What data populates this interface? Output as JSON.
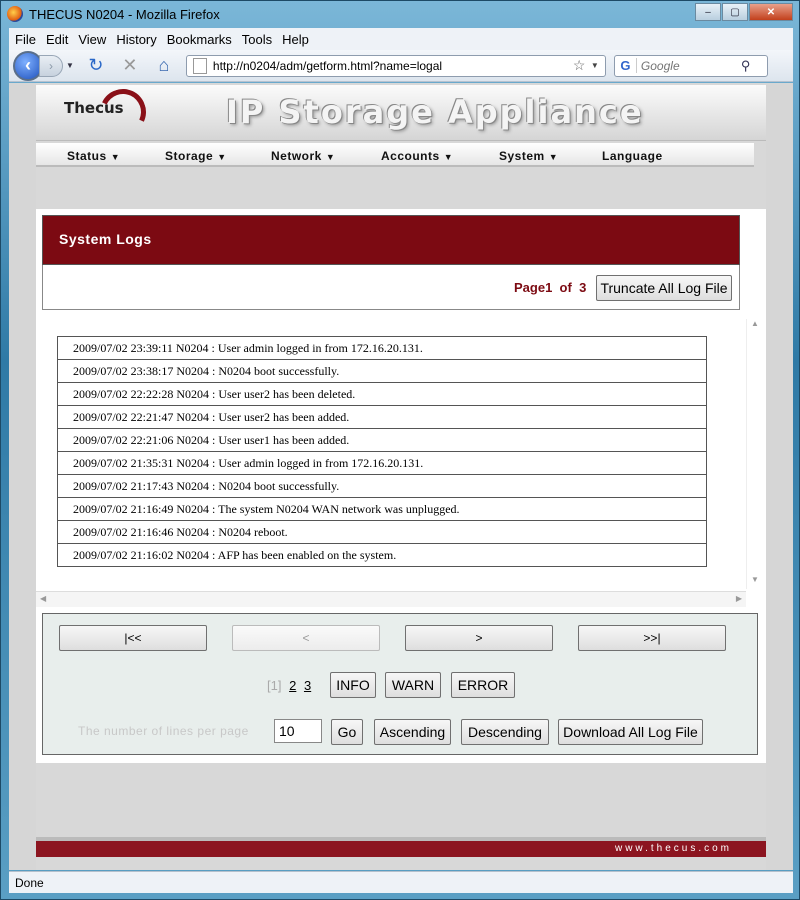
{
  "window": {
    "title": "THECUS N0204 - Mozilla Firefox",
    "buttons": {
      "minimize": "–",
      "maximize": "▢",
      "close": "✕"
    }
  },
  "menubar": {
    "items": [
      "File",
      "Edit",
      "View",
      "History",
      "Bookmarks",
      "Tools",
      "Help"
    ]
  },
  "navbar": {
    "url": "http://n0204/adm/getform.html?name=logal",
    "search_placeholder": "Google"
  },
  "header": {
    "logo": "Thecus",
    "tagline": "IP Storage Appliance"
  },
  "mainnav": {
    "items": [
      {
        "label": "Status",
        "arrow": true
      },
      {
        "label": "Storage",
        "arrow": true
      },
      {
        "label": "Network",
        "arrow": true
      },
      {
        "label": "Accounts",
        "arrow": true
      },
      {
        "label": "System",
        "arrow": true
      },
      {
        "label": "Language",
        "arrow": false
      }
    ]
  },
  "logs": {
    "title": "System Logs",
    "page_label": "Page",
    "page_current": "1",
    "page_of": "of",
    "page_total": "3",
    "truncate_label": "Truncate All Log File",
    "entries": [
      "2009/07/02 23:39:11 N0204 : User admin logged in from 172.16.20.131.",
      "2009/07/02 23:38:17 N0204 : N0204 boot successfully.",
      "2009/07/02 22:22:28 N0204 : User user2 has been deleted.",
      "2009/07/02 22:21:47 N0204 : User user2 has been added.",
      "2009/07/02 22:21:06 N0204 : User user1 has been added.",
      "2009/07/02 21:35:31 N0204 : User admin logged in from 172.16.20.131.",
      "2009/07/02 21:17:43 N0204 : N0204 boot successfully.",
      "2009/07/02 21:16:49 N0204 : The system N0204 WAN network was unplugged.",
      "2009/07/02 21:16:46 N0204 : N0204 reboot.",
      "2009/07/02 21:16:02 N0204 : AFP has been enabled on the system."
    ]
  },
  "controls": {
    "first": "|<<",
    "prev": "<",
    "next": ">",
    "last": ">>|",
    "page_current": "[1]",
    "page_links": [
      "2",
      "3"
    ],
    "info": "INFO",
    "warn": "WARN",
    "error": "ERROR",
    "lines_label": "The number of lines per page",
    "lines_value": "10",
    "go": "Go",
    "ascending": "Ascending",
    "descending": "Descending",
    "download": "Download All Log File"
  },
  "footer": {
    "text": "www.thecus.com"
  },
  "status": {
    "text": "Done"
  },
  "colors": {
    "brand_red": "#7c0a12",
    "footer_red": "#8c1520"
  }
}
